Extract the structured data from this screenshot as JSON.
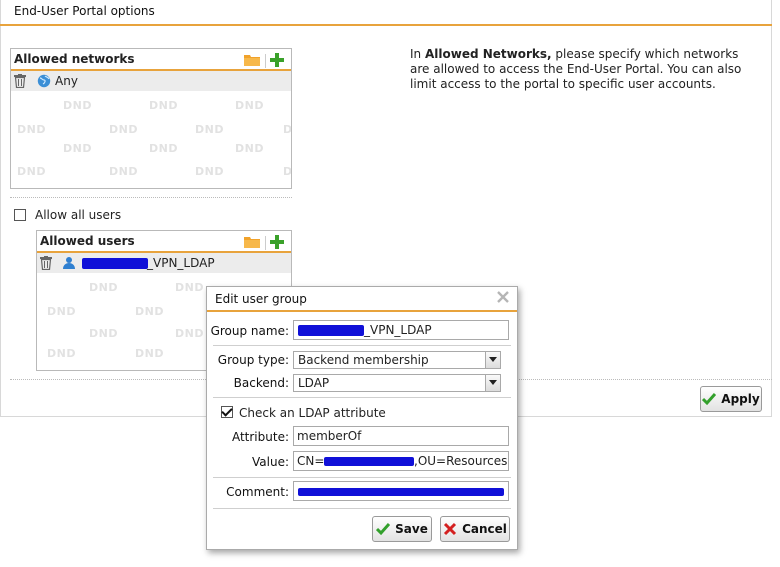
{
  "panel": {
    "title": "End-User Portal options"
  },
  "allowed_networks": {
    "title": "Allowed networks",
    "items": [
      {
        "label": "Any",
        "icon": "globe-icon"
      }
    ]
  },
  "help": {
    "prefix": "In ",
    "bold": "Allowed Networks,",
    "suffix": " please specify which networks are allowed to access the End-User Portal. You can also limit access to the portal to specific user accounts."
  },
  "allow_all_users": {
    "label": "Allow all users",
    "checked": false
  },
  "allowed_users": {
    "title": "Allowed users",
    "items": [
      {
        "label_visible": "_VPN_LDAP",
        "icon": "user-icon"
      }
    ]
  },
  "dnd_text": "DND",
  "apply_button": {
    "label": "Apply"
  },
  "dialog": {
    "title": "Edit user group",
    "group_name": {
      "label": "Group name:",
      "value_visible": "_VPN_LDAP"
    },
    "group_type": {
      "label": "Group type:",
      "value": "Backend membership"
    },
    "backend": {
      "label": "Backend:",
      "value": "LDAP"
    },
    "check_ldap": {
      "label": "Check an LDAP attribute",
      "checked": true
    },
    "attribute": {
      "label": "Attribute:",
      "value": "memberOf"
    },
    "value": {
      "label": "Value:",
      "prefix": "CN=",
      "suffix": ",OU=Resources,"
    },
    "comment": {
      "label": "Comment:"
    },
    "save_button": {
      "label": "Save"
    },
    "cancel_button": {
      "label": "Cancel"
    }
  },
  "colors": {
    "accent": "#e8a33c",
    "plus_green": "#3aa12a",
    "redaction": "#1010d8"
  }
}
